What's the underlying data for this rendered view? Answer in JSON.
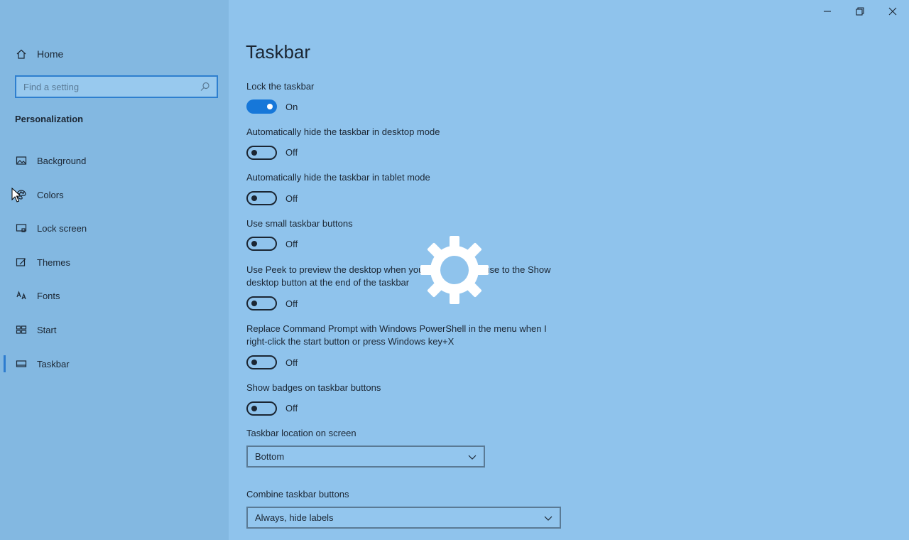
{
  "window": {
    "controls": [
      "minimize",
      "restore",
      "close"
    ]
  },
  "sidebar": {
    "home_label": "Home",
    "search_placeholder": "Find a setting",
    "search_value": "",
    "section": "Personalization",
    "items": [
      {
        "label": "Background",
        "icon": "picture-icon"
      },
      {
        "label": "Colors",
        "icon": "palette-icon"
      },
      {
        "label": "Lock screen",
        "icon": "lock-screen-icon"
      },
      {
        "label": "Themes",
        "icon": "themes-icon"
      },
      {
        "label": "Fonts",
        "icon": "fonts-icon"
      },
      {
        "label": "Start",
        "icon": "start-icon"
      },
      {
        "label": "Taskbar",
        "icon": "taskbar-icon",
        "active": true
      }
    ]
  },
  "main": {
    "title": "Taskbar",
    "settings": [
      {
        "label": "Lock the taskbar",
        "state": "On"
      },
      {
        "label": "Automatically hide the taskbar in desktop mode",
        "state": "Off"
      },
      {
        "label": "Automatically hide the taskbar in tablet mode",
        "state": "Off"
      },
      {
        "label": "Use small taskbar buttons",
        "state": "Off"
      },
      {
        "label": "Use Peek to preview the desktop when you move your mouse to the Show desktop button at the end of the taskbar",
        "state": "Off"
      },
      {
        "label": "Replace Command Prompt with Windows PowerShell in the menu when I right-click the start button or press Windows key+X",
        "state": "Off"
      },
      {
        "label": "Show badges on taskbar buttons",
        "state": "Off"
      }
    ],
    "location_label": "Taskbar location on screen",
    "location_value": "Bottom",
    "combine_label": "Combine taskbar buttons",
    "combine_value": "Always, hide labels"
  },
  "colors": {
    "accent": "#1677d9",
    "background": "#8fc3ec",
    "sidebar": "#83b8e1"
  }
}
